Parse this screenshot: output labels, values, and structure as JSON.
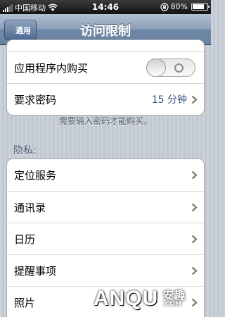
{
  "statusbar": {
    "carrier": "中国移动",
    "time": "14:46",
    "battery_percent": "80%",
    "battery_level": 0.8
  },
  "navbar": {
    "back_label": "通用",
    "title": "访问限制"
  },
  "top_group": {
    "in_app_purchase_label": "应用程序内购买",
    "in_app_purchase_on": false,
    "require_password_label": "要求密码",
    "require_password_value": "15 分钟"
  },
  "footnote": "需要输入密码才能购买。",
  "privacy": {
    "header": "隐私:",
    "items": [
      {
        "label": "定位服务"
      },
      {
        "label": "通讯录"
      },
      {
        "label": "日历"
      },
      {
        "label": "提醒事项"
      },
      {
        "label": "照片"
      }
    ]
  },
  "watermark": {
    "main": "ANQU",
    "cn": "安趣",
    "com": ".COM"
  },
  "colors": {
    "value_blue": "#385487",
    "navbar": "#6f87a6",
    "background": "#c5ccd4"
  }
}
